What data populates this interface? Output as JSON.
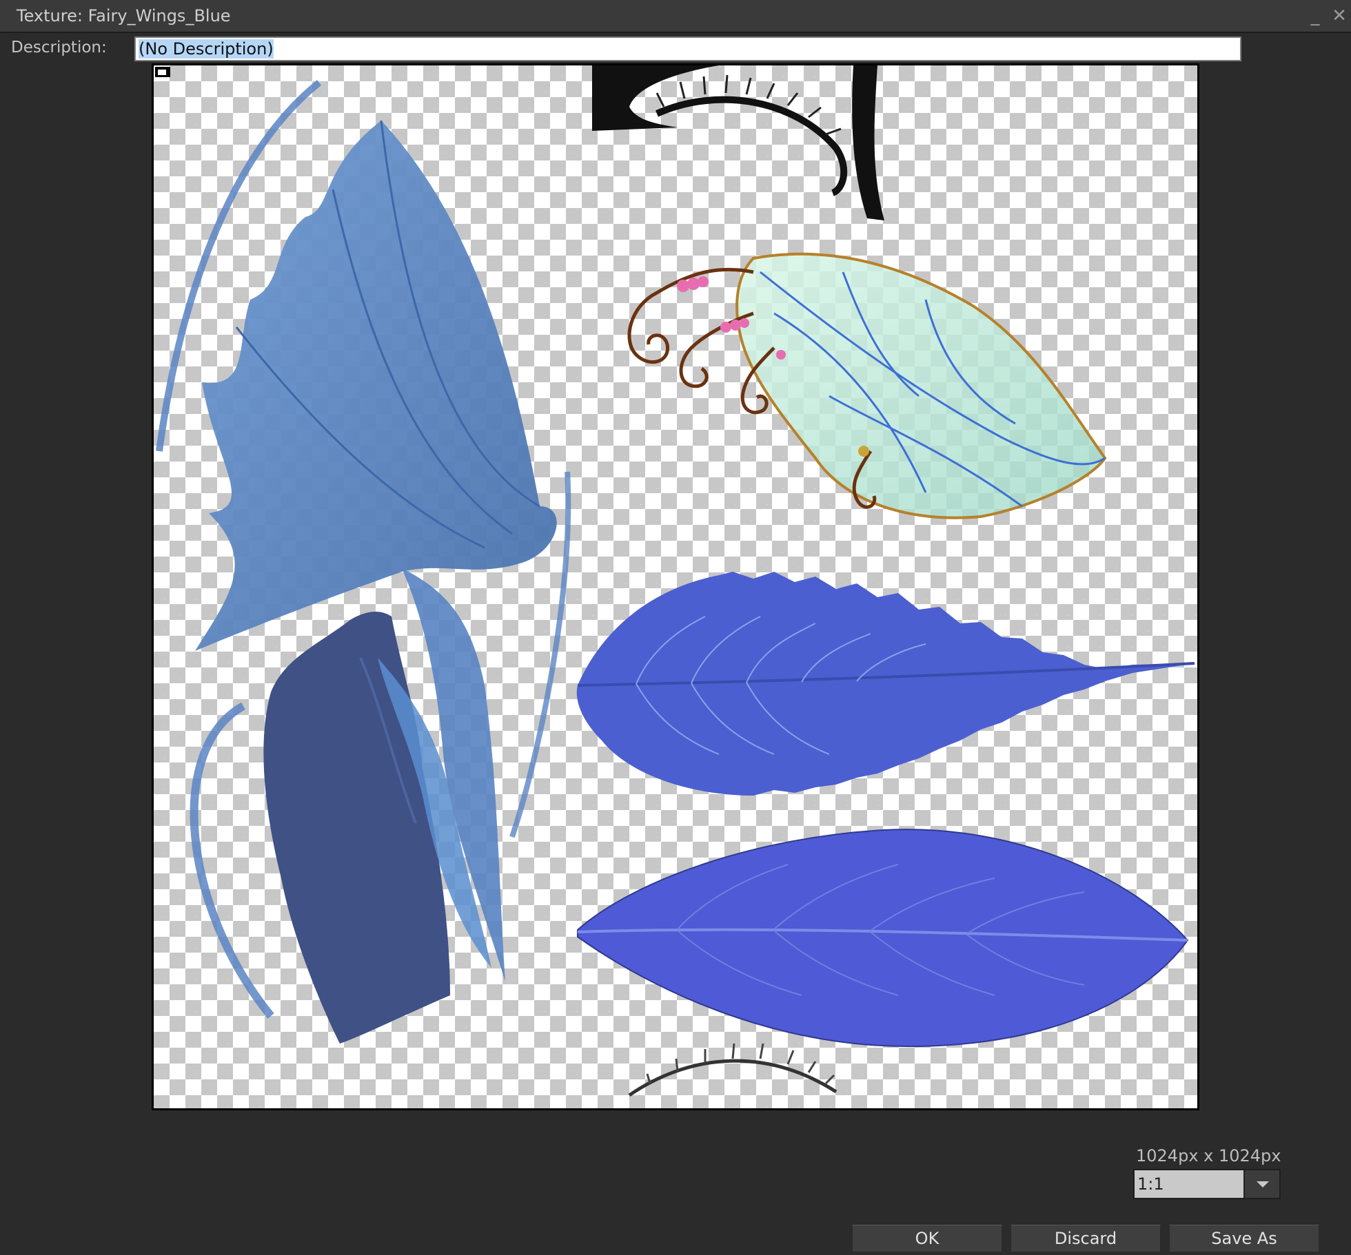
{
  "window": {
    "title": "Texture: Fairy_Wings_Blue",
    "minimize_glyph": "_",
    "close_glyph": "✕"
  },
  "description": {
    "label": "Description:",
    "value": "(No Description)"
  },
  "texture": {
    "size_text": "1024px x 1024px",
    "zoom_value": "1:1"
  },
  "buttons": {
    "ok": "OK",
    "discard": "Discard",
    "save_as": "Save As"
  },
  "colors": {
    "window_bg": "#2b2b2b",
    "hair_blue": "#5f8ac4",
    "leaf_blue": "#4b5fd1",
    "wing_green": "#bfead6",
    "selection": "#b5d6f7"
  }
}
